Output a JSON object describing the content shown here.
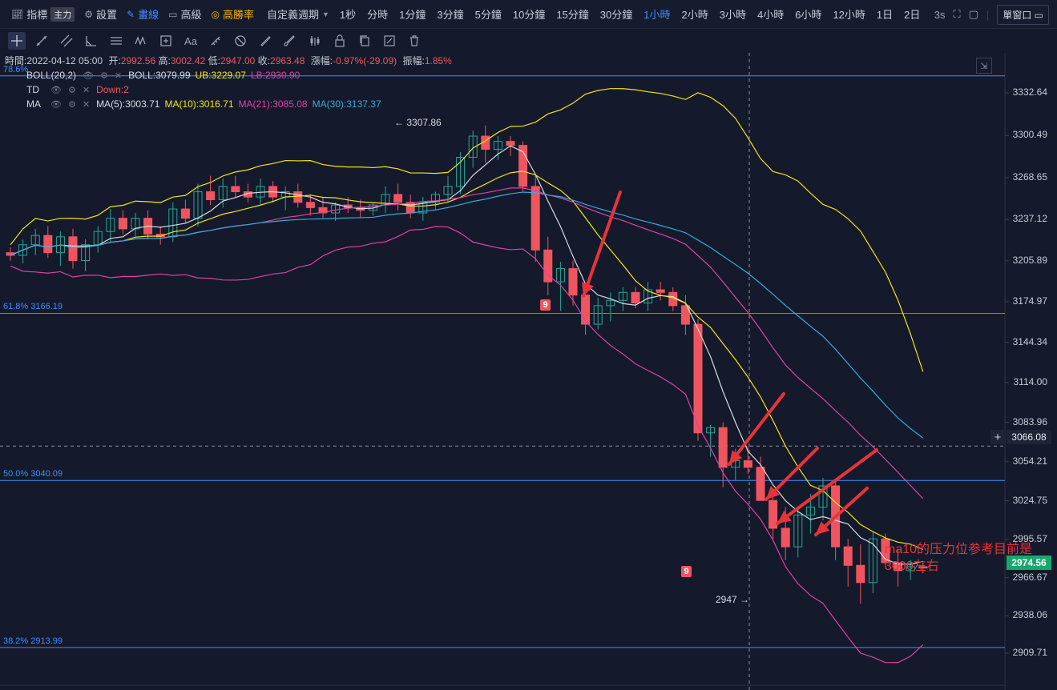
{
  "toolbar": {
    "indicators": "指標",
    "indicators_badge": "主力",
    "settings": "設置",
    "draw": "畫線",
    "advanced": "高級",
    "winrate": "高勝率",
    "custom_period": "自定義週期",
    "periods": [
      "1秒",
      "分時",
      "1分鐘",
      "3分鐘",
      "5分鐘",
      "10分鐘",
      "15分鐘",
      "30分鐘",
      "1小時",
      "2小時",
      "3小時",
      "4小時",
      "6小時",
      "12小時",
      "1日",
      "2日"
    ],
    "active_period": "1小時",
    "refresh": "3s",
    "window_mode": "單窗口"
  },
  "info": {
    "time_label": "時間:",
    "time": "2022-04-12 05:00",
    "open_label": "开:",
    "open": "2992.56",
    "high_label": "高:",
    "high": "3002.42",
    "low_label": "低:",
    "low": "2947.00",
    "close_label": "收:",
    "close": "2963.48",
    "change_label": "漲幅:",
    "change": "-0.97%(-29.09)",
    "amp_label": "振幅:",
    "amp": "1.85%"
  },
  "indicators": {
    "boll": {
      "name": "BOLL(20,2)",
      "mid": "BOLL:3079.99",
      "ub": "UB:3229.07",
      "lb": "LB:2930.90"
    },
    "td": {
      "name": "TD",
      "down": "Down:2"
    },
    "ma": {
      "name": "MA",
      "ma5": "MA(5):3003.71",
      "ma10": "MA(10):3016.71",
      "ma21": "MA(21):3085.08",
      "ma30": "MA(30):3137.37"
    }
  },
  "fib": [
    {
      "label": "78.6%",
      "price": 3345.5
    },
    {
      "label": "61.8% 3166.19",
      "price": 3166.19
    },
    {
      "label": "50.0% 3040.09",
      "price": 3040.09
    },
    {
      "label": "38.2% 2913.99",
      "price": 2913.99
    }
  ],
  "axis": {
    "ticks": [
      "3332.64",
      "3300.49",
      "3268.65",
      "3237.12",
      "3205.89",
      "3174.97",
      "3144.34",
      "3114.00",
      "3083.96",
      "3054.21",
      "3024.75",
      "2995.57",
      "2966.67",
      "2938.06",
      "2909.71"
    ],
    "last_price": "2974.56",
    "crosshair_price": "3066.08"
  },
  "chart_data": {
    "type": "candlestick",
    "ylim": [
      2900,
      3350
    ],
    "high_marker": "3307.86",
    "low_marker": "2947",
    "td_marker": "9",
    "candles": [
      [
        3212,
        3216,
        3206,
        3210
      ],
      [
        3210,
        3222,
        3204,
        3218
      ],
      [
        3218,
        3230,
        3210,
        3225
      ],
      [
        3225,
        3232,
        3208,
        3212
      ],
      [
        3212,
        3228,
        3202,
        3224
      ],
      [
        3224,
        3230,
        3200,
        3206
      ],
      [
        3206,
        3222,
        3198,
        3218
      ],
      [
        3218,
        3232,
        3212,
        3228
      ],
      [
        3228,
        3245,
        3220,
        3238
      ],
      [
        3238,
        3244,
        3226,
        3230
      ],
      [
        3230,
        3242,
        3224,
        3238
      ],
      [
        3238,
        3244,
        3222,
        3226
      ],
      [
        3226,
        3232,
        3218,
        3224
      ],
      [
        3224,
        3250,
        3220,
        3245
      ],
      [
        3245,
        3252,
        3234,
        3238
      ],
      [
        3238,
        3264,
        3232,
        3258
      ],
      [
        3258,
        3270,
        3248,
        3252
      ],
      [
        3252,
        3268,
        3246,
        3262
      ],
      [
        3262,
        3270,
        3254,
        3258
      ],
      [
        3258,
        3264,
        3250,
        3254
      ],
      [
        3254,
        3268,
        3248,
        3262
      ],
      [
        3262,
        3266,
        3250,
        3254
      ],
      [
        3254,
        3262,
        3244,
        3258
      ],
      [
        3258,
        3264,
        3246,
        3250
      ],
      [
        3250,
        3256,
        3240,
        3246
      ],
      [
        3246,
        3254,
        3238,
        3242
      ],
      [
        3242,
        3250,
        3236,
        3248
      ],
      [
        3248,
        3254,
        3242,
        3246
      ],
      [
        3246,
        3252,
        3238,
        3244
      ],
      [
        3244,
        3250,
        3240,
        3248
      ],
      [
        3248,
        3262,
        3242,
        3256
      ],
      [
        3256,
        3264,
        3244,
        3250
      ],
      [
        3250,
        3256,
        3238,
        3242
      ],
      [
        3242,
        3254,
        3236,
        3250
      ],
      [
        3250,
        3258,
        3244,
        3256
      ],
      [
        3256,
        3270,
        3250,
        3262
      ],
      [
        3262,
        3288,
        3256,
        3284
      ],
      [
        3284,
        3304,
        3276,
        3300
      ],
      [
        3300,
        3308,
        3280,
        3290
      ],
      [
        3290,
        3300,
        3282,
        3296
      ],
      [
        3296,
        3300,
        3285,
        3293
      ],
      [
        3293,
        3296,
        3258,
        3262
      ],
      [
        3262,
        3270,
        3205,
        3214
      ],
      [
        3214,
        3224,
        3180,
        3190
      ],
      [
        3190,
        3205,
        3168,
        3200
      ],
      [
        3200,
        3206,
        3172,
        3180
      ],
      [
        3180,
        3186,
        3150,
        3158
      ],
      [
        3158,
        3178,
        3154,
        3172
      ],
      [
        3172,
        3182,
        3160,
        3176
      ],
      [
        3176,
        3186,
        3168,
        3182
      ],
      [
        3182,
        3186,
        3170,
        3174
      ],
      [
        3174,
        3190,
        3168,
        3184
      ],
      [
        3184,
        3190,
        3176,
        3182
      ],
      [
        3182,
        3186,
        3168,
        3172
      ],
      [
        3172,
        3180,
        3150,
        3158
      ],
      [
        3158,
        3162,
        3070,
        3076
      ],
      [
        3076,
        3082,
        3058,
        3080
      ],
      [
        3080,
        3084,
        3035,
        3050
      ],
      [
        3050,
        3064,
        3040,
        3055
      ],
      [
        3055,
        3066,
        3045,
        3050
      ],
      [
        3050,
        3058,
        3032,
        3025
      ],
      [
        3025,
        3034,
        2996,
        3004
      ],
      [
        3004,
        3020,
        2980,
        2990
      ],
      [
        2990,
        3020,
        2982,
        3014
      ],
      [
        3014,
        3030,
        3000,
        3020
      ],
      [
        3020,
        3042,
        3010,
        3036
      ],
      [
        3036,
        3040,
        2980,
        2990
      ],
      [
        2990,
        2996,
        2960,
        2976
      ],
      [
        2976,
        2992,
        2947,
        2963
      ],
      [
        2963,
        3002,
        2955,
        2996
      ],
      [
        2996,
        3000,
        2974,
        2978
      ],
      [
        2978,
        2988,
        2960,
        2972
      ],
      [
        2972,
        2980,
        2965,
        2975
      ],
      [
        2975,
        2978,
        2970,
        2974
      ]
    ]
  },
  "annotation": {
    "line1": "ma10的压力位参考目前是",
    "line2": "3000左右"
  },
  "colors": {
    "up": "#26a69a",
    "down": "#f0555f",
    "bg": "#141a2b",
    "fib": "#3f8cff",
    "ma10": "#f3e21c",
    "ma21": "#e040a8",
    "ma30": "#3aa8d8",
    "ma5": "#d8dbe3",
    "arrow": "#e8333a"
  }
}
